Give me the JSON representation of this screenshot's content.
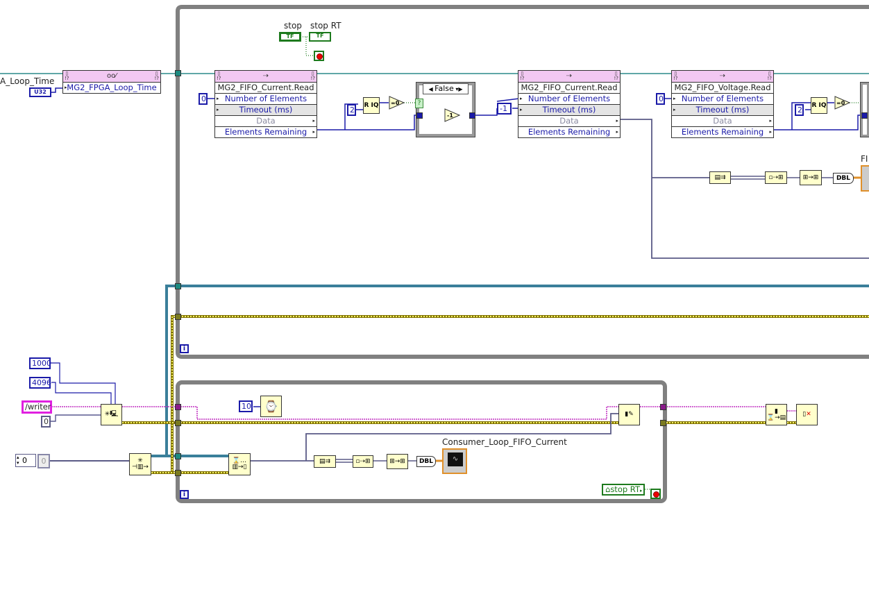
{
  "diagram": {
    "outside_left": {
      "loop_time_label": "A_Loop_Time",
      "u32_const": "U32",
      "fpga_property_node": {
        "icon": "glasses-pencil-icon",
        "terminal": "MG2_FPGA_Loop_Time"
      }
    },
    "top_loop": {
      "stop_control_label": "stop",
      "stop_control_value": "TF",
      "stop_local_label": "stop RT",
      "stop_local_value": "TF",
      "iteration_label": "i",
      "fifo_read_1": {
        "method": "MG2_FIFO_Current.Read",
        "rows": [
          "Number of Elements",
          "Timeout (ms)",
          "Data",
          "Elements Remaining"
        ],
        "number_const": "0"
      },
      "quotient_const": "2",
      "quotient_node": "R IQ",
      "equal_zero": "=0",
      "case_structure": {
        "selector": "False",
        "select_indicator": "?",
        "decrement": "-1"
      },
      "fifo_read_2": {
        "method": "MG2_FIFO_Current.Read",
        "rows": [
          "Number of Elements",
          "Timeout (ms)",
          "Data",
          "Elements Remaining"
        ],
        "timeout_const": "-1"
      },
      "fifo_read_3": {
        "method": "MG2_FIFO_Voltage.Read",
        "rows": [
          "Number of Elements",
          "Timeout (ms)",
          "Data",
          "Elements Remaining"
        ],
        "number_const": "0"
      },
      "quotient_const_2": "2",
      "equal_zero_2": "=0",
      "dbl_conversion": "DBL",
      "partial_indicator_label": "FI"
    },
    "left_side": {
      "const_1000": "1000",
      "const_4096": "4096",
      "writer_path": "/writer",
      "const_0": "0",
      "numeric_control_value": "0",
      "numeric_indicator_value": "0"
    },
    "bottom_loop": {
      "wait_ms_const": "10",
      "graph_label": "Consumer_Loop_FIFO_Current",
      "dbl_conversion": "DBL",
      "stop_local_label": "stop RT",
      "iteration_label": "i"
    }
  }
}
